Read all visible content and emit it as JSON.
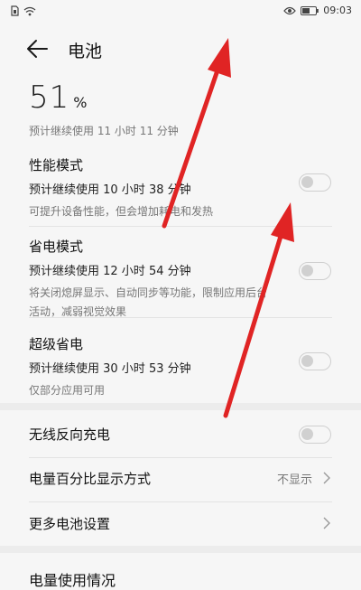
{
  "status_bar": {
    "time": "09:03"
  },
  "header": {
    "title": "电池"
  },
  "battery": {
    "level": "51",
    "unit": "%",
    "remaining": "预计继续使用 11 小时 11 分钟"
  },
  "modes": [
    {
      "title": "性能模式",
      "estimate": "预计继续使用 10 小时 38 分钟",
      "description": "可提升设备性能，但会增加耗电和发热",
      "enabled": false
    },
    {
      "title": "省电模式",
      "estimate": "预计继续使用 12 小时 54 分钟",
      "description": "将关闭熄屏显示、自动同步等功能，限制应用后台活动，减弱视觉效果",
      "enabled": false
    },
    {
      "title": "超级省电",
      "estimate": "预计继续使用 30 小时 53 分钟",
      "description": "仅部分应用可用",
      "enabled": false
    }
  ],
  "settings": {
    "wireless_reverse": {
      "label": "无线反向充电",
      "enabled": false
    },
    "percentage_display": {
      "label": "电量百分比显示方式",
      "value": "不显示"
    },
    "more_settings": {
      "label": "更多电池设置"
    }
  },
  "usage": {
    "title": "电量使用情况"
  },
  "colors": {
    "arrow": "#e02424",
    "background": "#f6f6f6"
  }
}
